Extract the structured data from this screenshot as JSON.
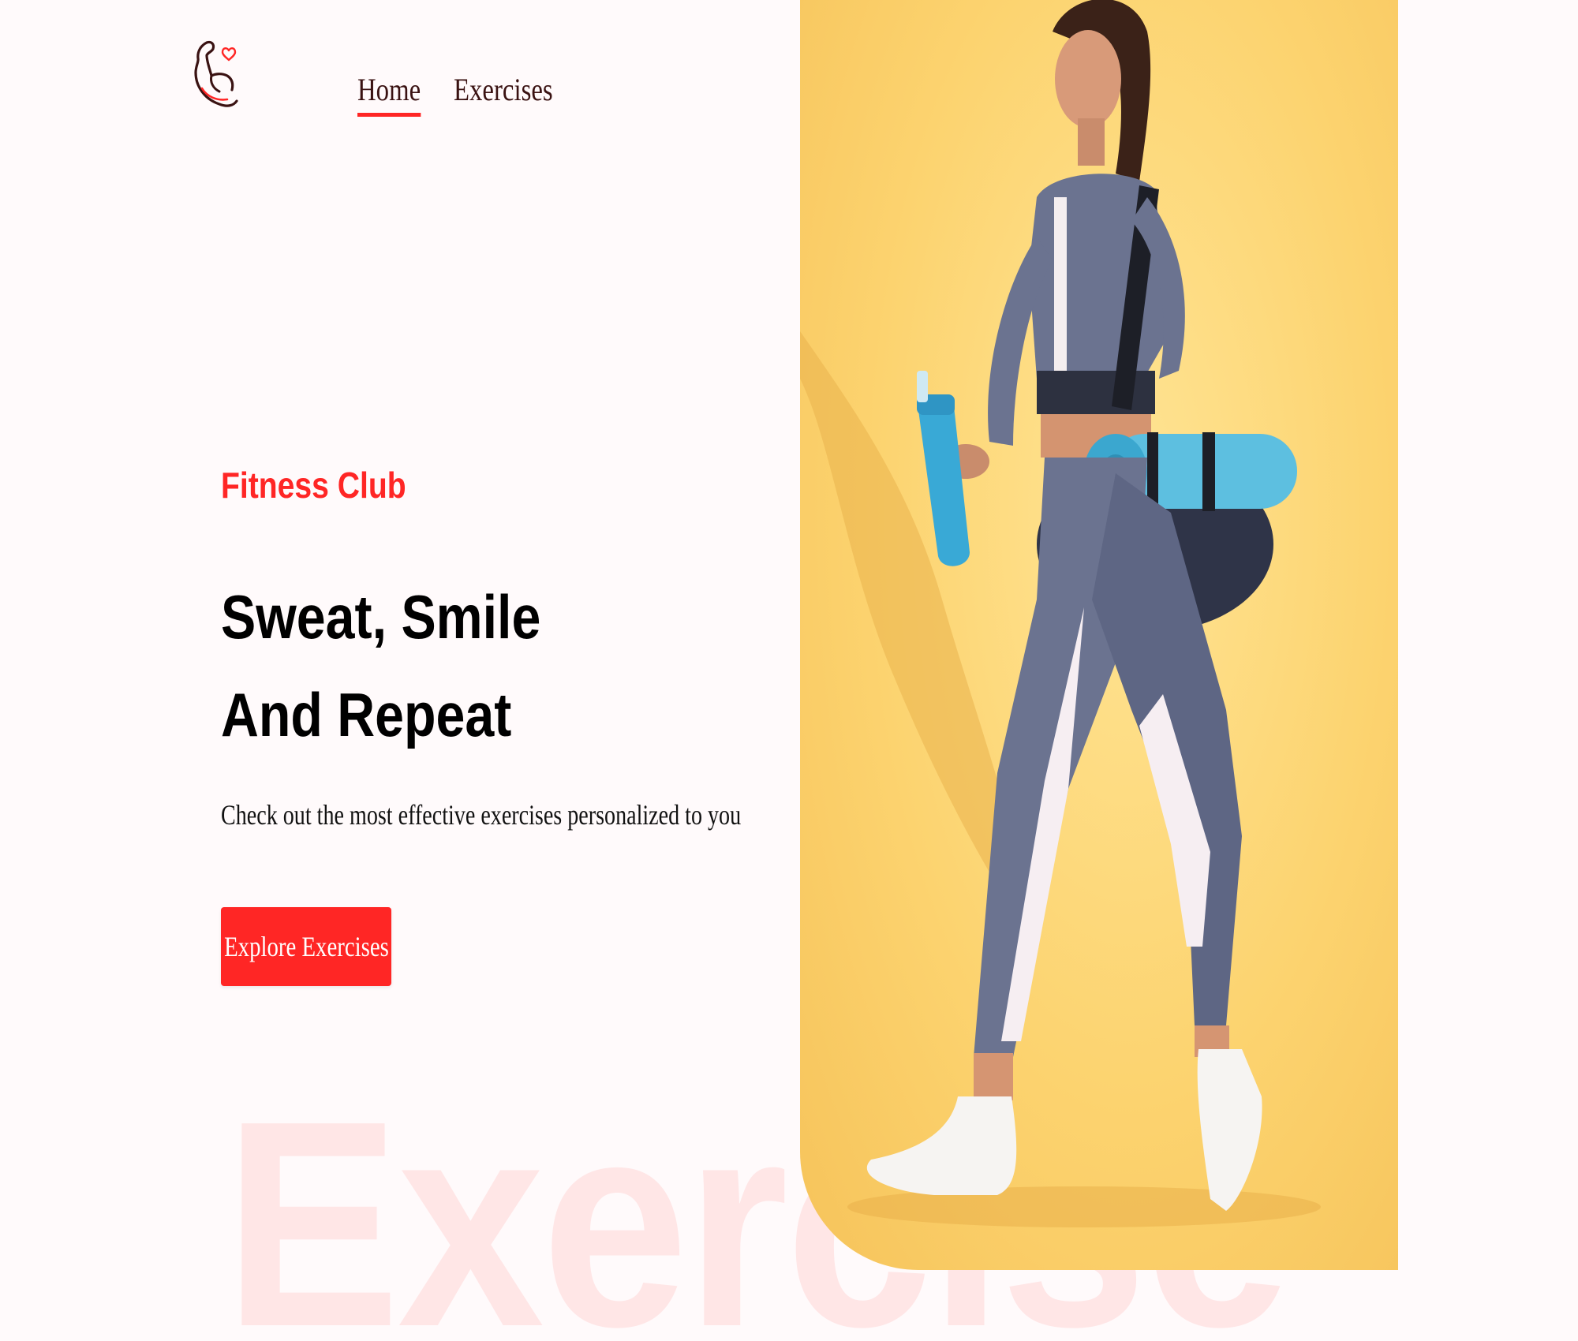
{
  "brand": {
    "logo_icon": "flexed-bicep-heart-icon",
    "accent_color": "#ff2625"
  },
  "nav": {
    "items": [
      {
        "label": "Home",
        "active": true
      },
      {
        "label": "Exercises",
        "active": false
      }
    ]
  },
  "hero": {
    "subtitle": "Fitness Club",
    "title_line1": "Sweat, Smile",
    "title_line2": "And Repeat",
    "description": "Check out the most effective exercises personalized to you",
    "cta_label": "Explore Exercises",
    "watermark": "Exercise",
    "image_icon": "woman-with-gym-bag-photo"
  }
}
